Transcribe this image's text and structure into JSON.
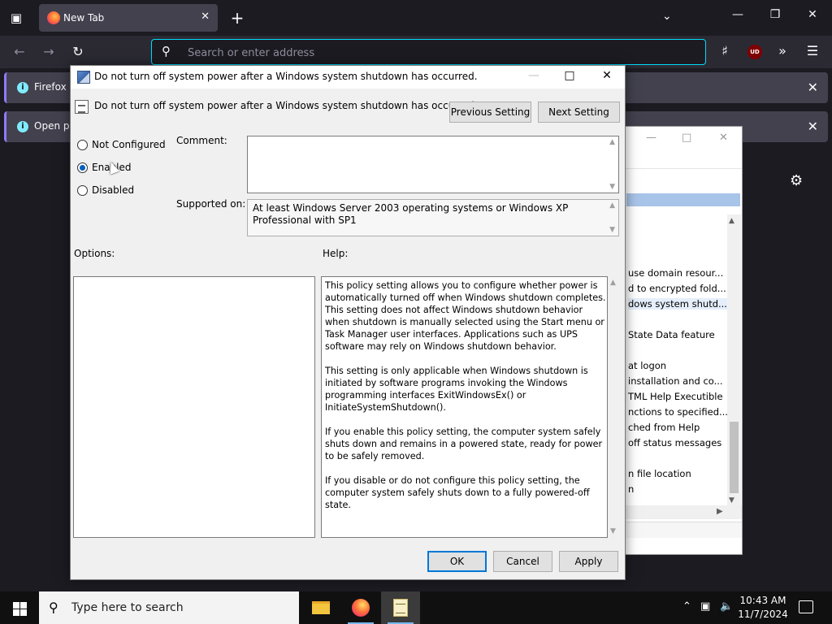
{
  "browser": {
    "tab_title": "New Tab",
    "url_placeholder": "Search or enter address",
    "notifications": [
      {
        "text": "Firefox a"
      },
      {
        "text": "Open pre"
      }
    ],
    "ublock_label": "UD"
  },
  "background_window": {
    "rows": [
      "use domain resour...",
      "d to encrypted fold...",
      "dows system shutd...",
      "State Data feature",
      "at logon",
      "installation and co...",
      "TML Help Executible",
      "nctions to specified...",
      "ched from Help",
      "off status messages",
      "n file location",
      "n"
    ]
  },
  "dialog": {
    "title": "Do not turn off system power after a Windows system shutdown has occurred.",
    "policy_name": "Do not turn off system power after a Windows system shutdown has occurred.",
    "previous_setting": "Previous Setting",
    "next_setting": "Next Setting",
    "radio_options": [
      {
        "label": "Not Configured",
        "selected": false
      },
      {
        "label": "Enabled",
        "selected": true
      },
      {
        "label": "Disabled",
        "selected": false
      }
    ],
    "comment_label": "Comment:",
    "comment_value": "",
    "supported_on_label": "Supported on:",
    "supported_on_value": "At least Windows Server 2003 operating systems or Windows XP Professional with SP1",
    "options_label": "Options:",
    "help_label": "Help:",
    "help_paragraphs": [
      "This policy setting allows you to configure whether power is automatically turned off when Windows shutdown completes. This setting does not affect Windows shutdown behavior when shutdown is manually selected using the Start menu or Task Manager user interfaces.  Applications such as UPS software may rely on Windows shutdown behavior.",
      "This setting is only applicable when Windows shutdown is initiated by software programs invoking the Windows programming interfaces ExitWindowsEx() or InitiateSystemShutdown().",
      "If you enable this policy setting, the computer system safely shuts down and remains in a powered state, ready for power to be safely removed.",
      "If you disable or do not configure this policy setting, the computer system safely shuts down to a fully powered-off state."
    ],
    "ok_label": "OK",
    "cancel_label": "Cancel",
    "apply_label": "Apply"
  },
  "taskbar": {
    "search_placeholder": "Type here to search",
    "time": "10:43 AM",
    "date": "11/7/2024"
  },
  "colors": {
    "accent_focus": "#00ddff",
    "taskbar_active_underline": "#76b9ed",
    "radio_selected": "#0060c0"
  }
}
